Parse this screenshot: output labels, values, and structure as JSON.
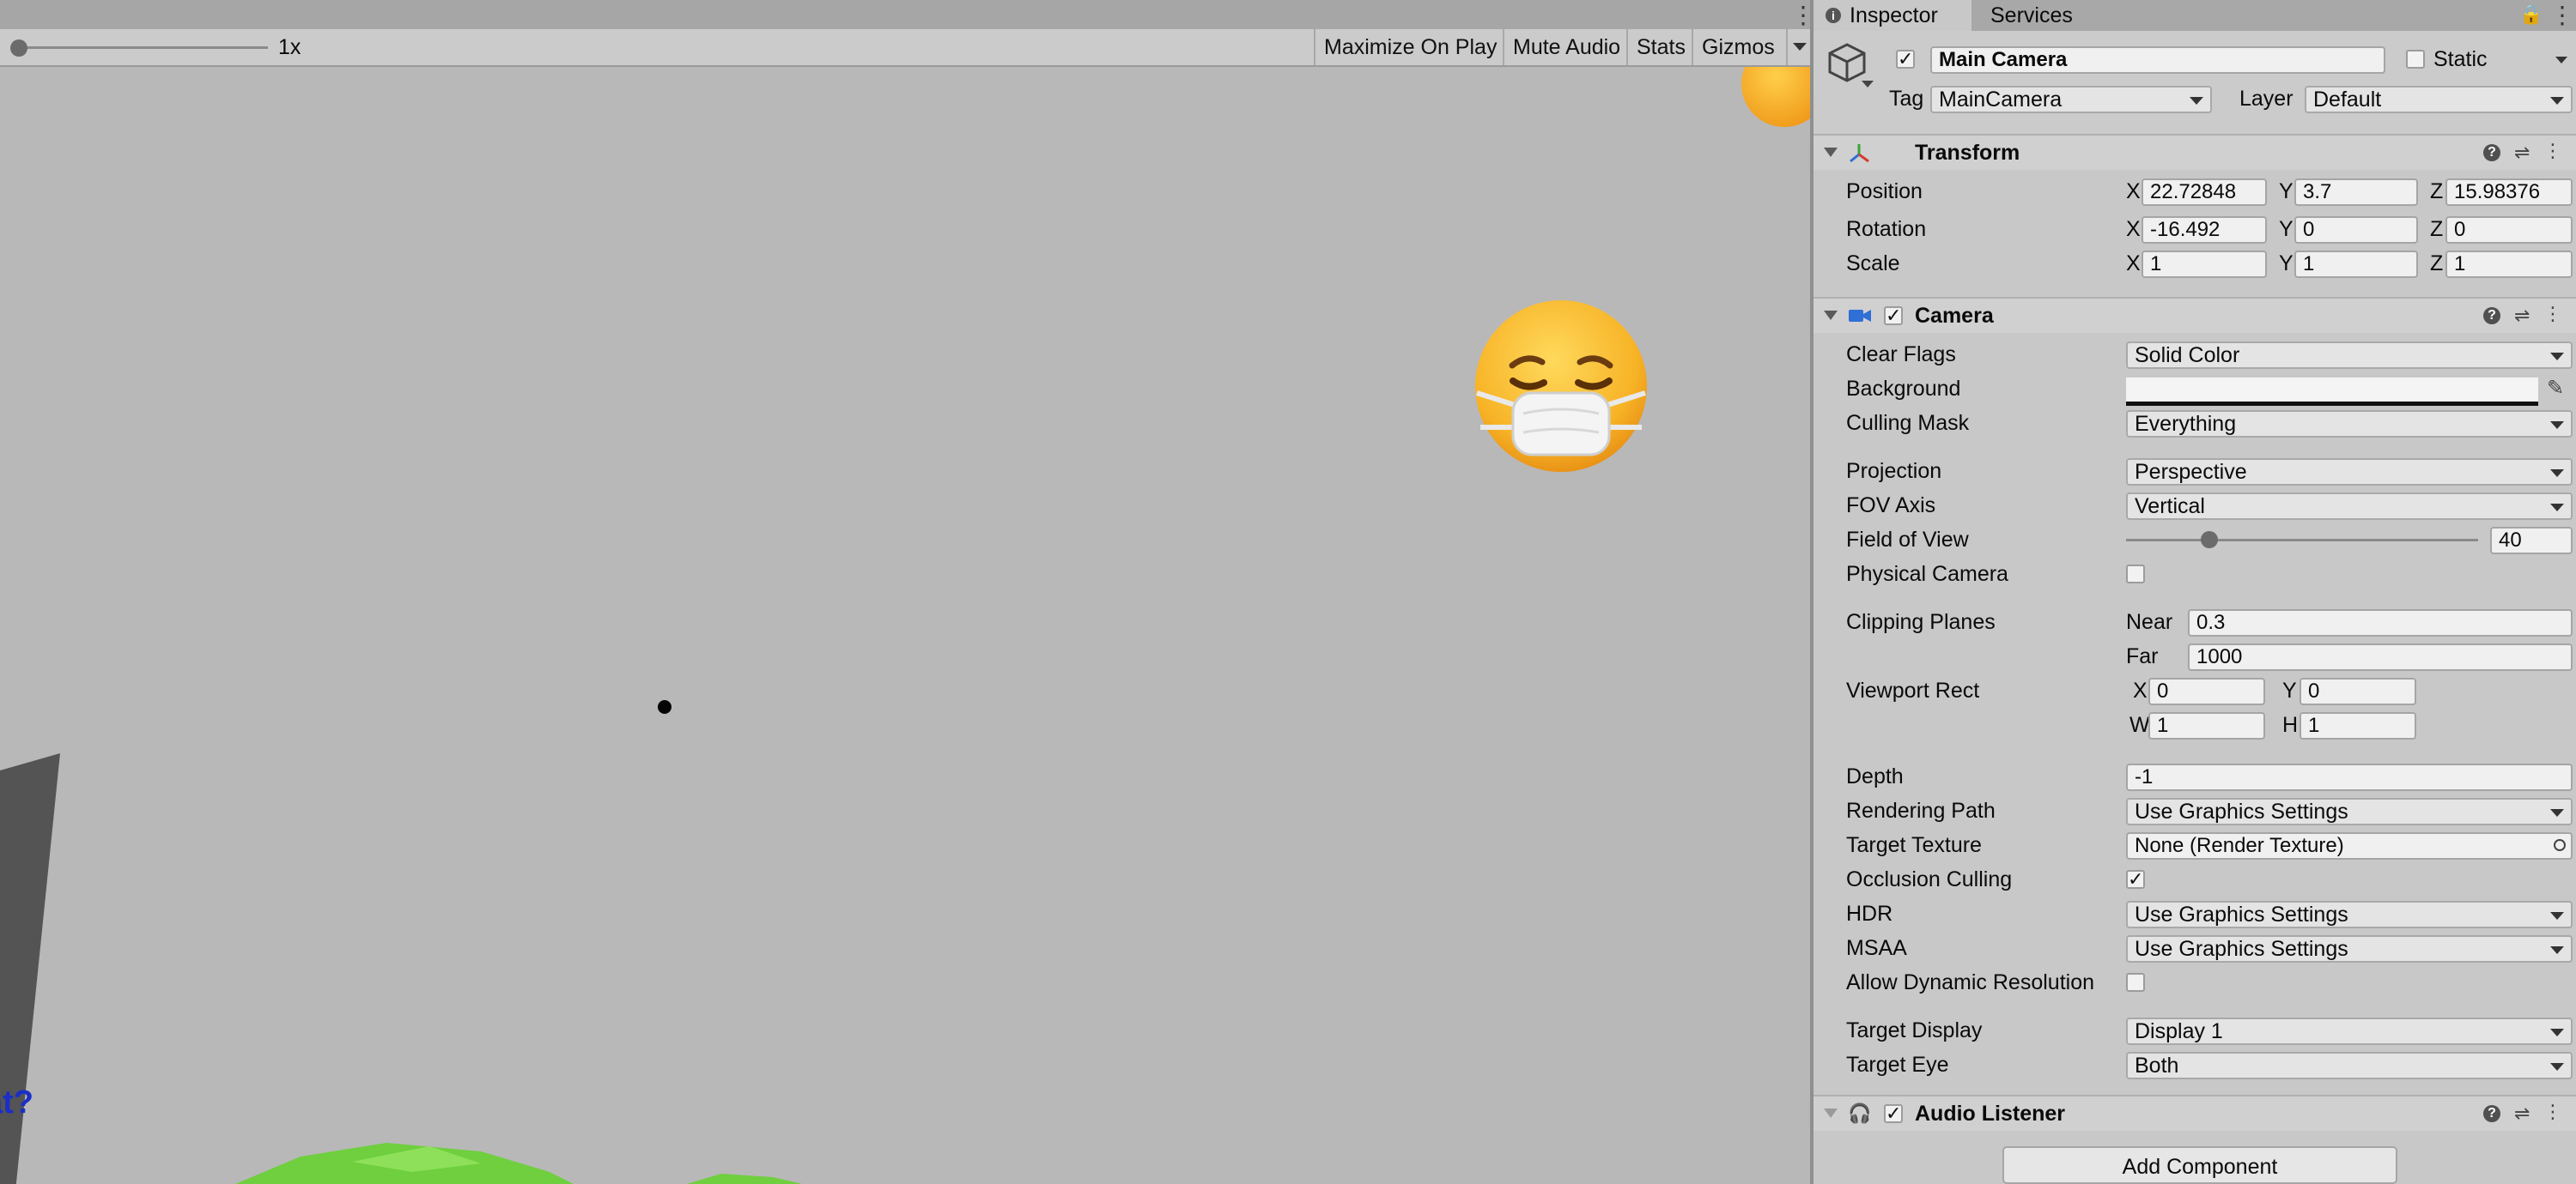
{
  "game": {
    "scale_label": "1x",
    "buttons": {
      "maximize": "Maximize On Play",
      "mute": "Mute Audio",
      "stats": "Stats",
      "gizmos": "Gizmos"
    },
    "partial_text": "at?"
  },
  "inspector": {
    "tabs": [
      "Inspector",
      "Services"
    ],
    "object": {
      "name": "Main Camera",
      "static_label": "Static",
      "tag_label": "Tag",
      "tag_value": "MainCamera",
      "layer_label": "Layer",
      "layer_value": "Default"
    },
    "transform": {
      "title": "Transform",
      "position": {
        "label": "Position",
        "x": "22.72848",
        "y": "3.7",
        "z": "15.98376"
      },
      "rotation": {
        "label": "Rotation",
        "x": "-16.492",
        "y": "0",
        "z": "0"
      },
      "scale": {
        "label": "Scale",
        "x": "1",
        "y": "1",
        "z": "1"
      },
      "axis_labels": [
        "X",
        "Y",
        "Z"
      ]
    },
    "camera": {
      "title": "Camera",
      "clear_flags": {
        "label": "Clear Flags",
        "value": "Solid Color"
      },
      "background": {
        "label": "Background",
        "color": "#f4f4f4"
      },
      "culling_mask": {
        "label": "Culling Mask",
        "value": "Everything"
      },
      "projection": {
        "label": "Projection",
        "value": "Perspective"
      },
      "fov_axis": {
        "label": "FOV Axis",
        "value": "Vertical"
      },
      "fov": {
        "label": "Field of View",
        "value": "40",
        "slider_fraction": 0.237
      },
      "physical_camera": {
        "label": "Physical Camera",
        "checked": false
      },
      "clipping": {
        "label": "Clipping Planes",
        "near_label": "Near",
        "near": "0.3",
        "far_label": "Far",
        "far": "1000"
      },
      "viewport": {
        "label": "Viewport Rect",
        "x": "0",
        "y": "0",
        "w": "1",
        "h": "1",
        "axis_labels": [
          "X",
          "Y",
          "W",
          "H"
        ]
      },
      "depth": {
        "label": "Depth",
        "value": "-1"
      },
      "rendering_path": {
        "label": "Rendering Path",
        "value": "Use Graphics Settings"
      },
      "target_texture": {
        "label": "Target Texture",
        "value": "None (Render Texture)"
      },
      "occlusion": {
        "label": "Occlusion Culling",
        "checked": true
      },
      "hdr": {
        "label": "HDR",
        "value": "Use Graphics Settings"
      },
      "msaa": {
        "label": "MSAA",
        "value": "Use Graphics Settings"
      },
      "dynamic_res": {
        "label": "Allow Dynamic Resolution",
        "checked": false
      },
      "target_display": {
        "label": "Target Display",
        "value": "Display 1"
      },
      "target_eye": {
        "label": "Target Eye",
        "value": "Both"
      }
    },
    "audio_listener": {
      "title": "Audio Listener"
    },
    "add_component": "Add Component"
  },
  "colors": {
    "game_bg": "#b8b8b8",
    "inspector_bg": "#c8c8c8",
    "camera_icon": "#2f6fd6",
    "grass": "#6fcf3e",
    "text_blue": "#1a2ec8"
  }
}
